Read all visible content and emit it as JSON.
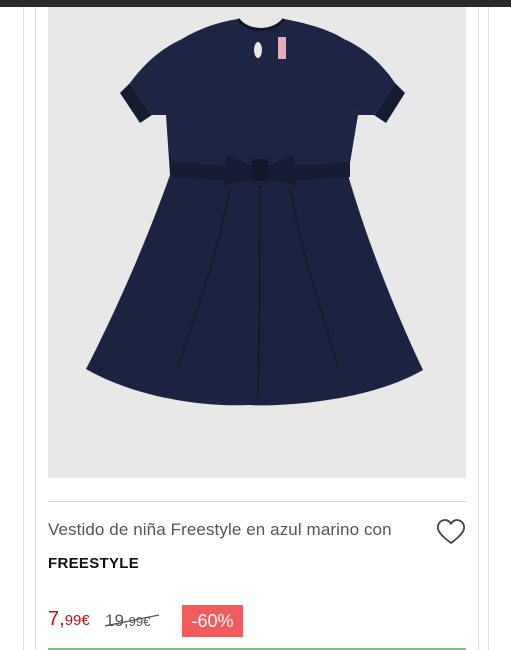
{
  "product": {
    "title": "Vestido de niña Freestyle en azul marino con",
    "brand": "FREESTYLE",
    "image": {
      "description_icon": "navy-dress-image",
      "background": "#e8e8e8",
      "garment_color": "#1c2340"
    },
    "price": {
      "current_main": "7,",
      "current_cents": "99€",
      "original_main": "19,",
      "original_cents": "99€",
      "discount": "-60%"
    },
    "wishlist_icon": "heart-outline-icon"
  },
  "colors": {
    "sale_price": "#c0101a",
    "discount_badge": "#f25c5c",
    "accent_bottom": "#7fc08c"
  }
}
